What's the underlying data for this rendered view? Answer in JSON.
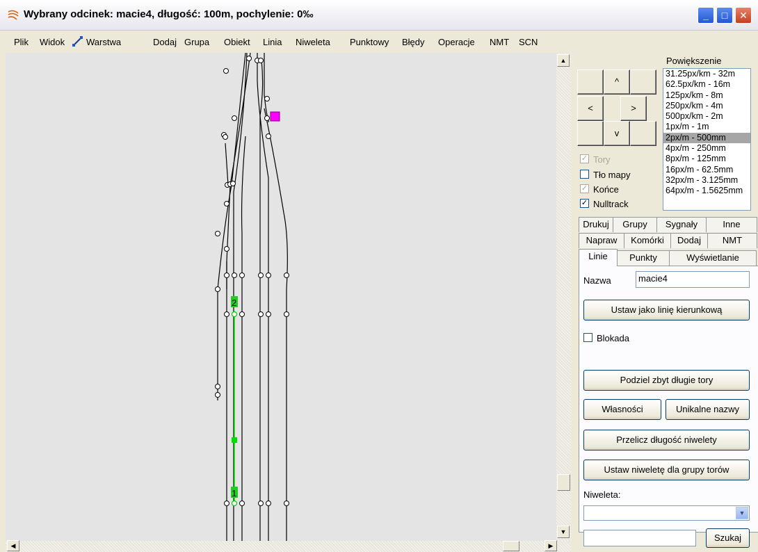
{
  "window": {
    "title": "Wybrany odcinek: macie4, długość: 100m, pochylenie: 0‰"
  },
  "menu": [
    "Plik",
    "Widok",
    "Warstwa",
    "Dodaj",
    "Grupa",
    "Obiekt",
    "Linia",
    "Niweleta",
    "Punktowy",
    "Błędy",
    "Operacje",
    "NMT",
    "SCN"
  ],
  "navigation": {
    "up": "^",
    "left": "<",
    "right": ">",
    "down": "v"
  },
  "zoom": {
    "label": "Powiększenie",
    "options": [
      "31.25px/km - 32m",
      "62.5px/km - 16m",
      "125px/km - 8m",
      "250px/km - 4m",
      "500px/km - 2m",
      "1px/m - 1m",
      "2px/m - 500mm",
      "4px/m - 250mm",
      "8px/m - 125mm",
      "16px/m - 62.5mm",
      "32px/m - 3.125mm",
      "64px/m - 1.5625mm"
    ],
    "selected": "2px/m - 500mm"
  },
  "checkboxes": {
    "tory": {
      "label": "Tory",
      "checked": true,
      "enabled": false
    },
    "tlo_mapy": {
      "label": "Tło mapy",
      "checked": false,
      "enabled": true
    },
    "konce": {
      "label": "Końce",
      "checked": true,
      "enabled": false
    },
    "nulltrack": {
      "label": "Nulltrack",
      "checked": true,
      "enabled": true
    }
  },
  "tabs": {
    "row1": [
      "Drukuj",
      "Grupy",
      "Sygnały",
      "Inne"
    ],
    "row2": [
      "Napraw",
      "Komórki",
      "Dodaj",
      "NMT"
    ],
    "row3": [
      "Linie",
      "Punkty",
      "Wyświetlanie"
    ],
    "active": "Linie"
  },
  "linie_tab": {
    "name_label": "Nazwa",
    "name_value": "macie4",
    "set_direction_button": "Ustaw jako linię kierunkową",
    "blokada_label": "Blokada",
    "blokada_checked": false,
    "split_button": "Podziel zbyt długie tory",
    "properties_button": "Własności",
    "unique_names_button": "Unikalne nazwy",
    "recalc_button": "Przelicz długość niwelety",
    "set_grade_button": "Ustaw niweletę dla grupy torów",
    "niweleta_label": "Niweleta:",
    "niweleta_value": "",
    "search_value": "",
    "search_button": "Szukaj"
  },
  "canvas": {
    "markers": [
      "2",
      "1"
    ],
    "colors": {
      "background": "#e4e4e4",
      "track": "#000000",
      "selected_track": "#00ee00",
      "highlight": "#ff00ff"
    }
  }
}
